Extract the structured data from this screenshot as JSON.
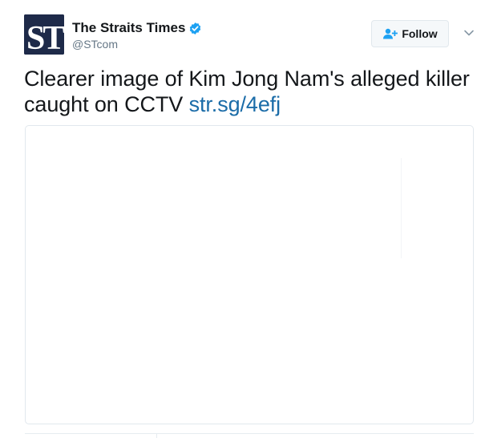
{
  "account": {
    "display_name": "The Straits Times",
    "handle": "@STcom",
    "avatar_letters": "ST",
    "verified": true
  },
  "actions": {
    "follow_label": "Follow"
  },
  "tweet": {
    "text": "Clearer image of Kim Jong Nam's alleged killer caught on CCTV ",
    "link_text": "str.sg/4efj"
  },
  "icons": {
    "verified": "verified-badge-icon",
    "follow": "follow-user-icon",
    "caret": "chevron-down-icon"
  },
  "colors": {
    "avatar_bg": "#1e2a49",
    "verified_blue": "#1da1f2",
    "link_blue": "#1b6ca8",
    "handle_gray": "#657786"
  }
}
